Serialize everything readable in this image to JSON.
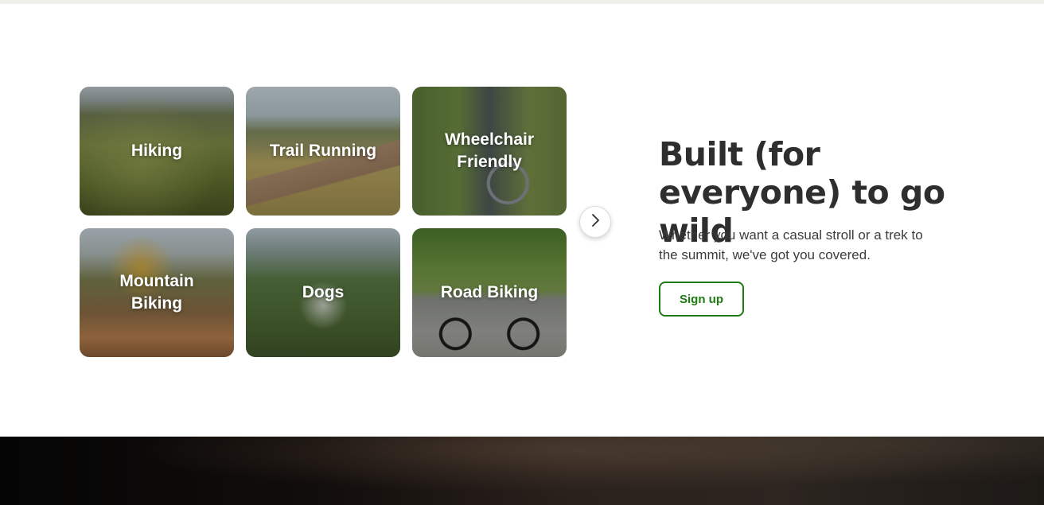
{
  "activities": [
    {
      "label": "Hiking"
    },
    {
      "label": "Trail Running"
    },
    {
      "label": "Wheelchair Friendly"
    },
    {
      "label": "Mountain Biking"
    },
    {
      "label": "Dogs"
    },
    {
      "label": "Road Biking"
    }
  ],
  "carousel": {
    "next_icon": "chevron-right-icon"
  },
  "promo": {
    "headline": "Built (for everyone) to go wild",
    "subtext": "Whether you want a casual stroll or a trek to the summit, we've got you covered.",
    "signup_label": "Sign up"
  },
  "colors": {
    "accent": "#1d7c10",
    "headline": "#2e2e2e",
    "body_text": "#3c3c3c"
  }
}
